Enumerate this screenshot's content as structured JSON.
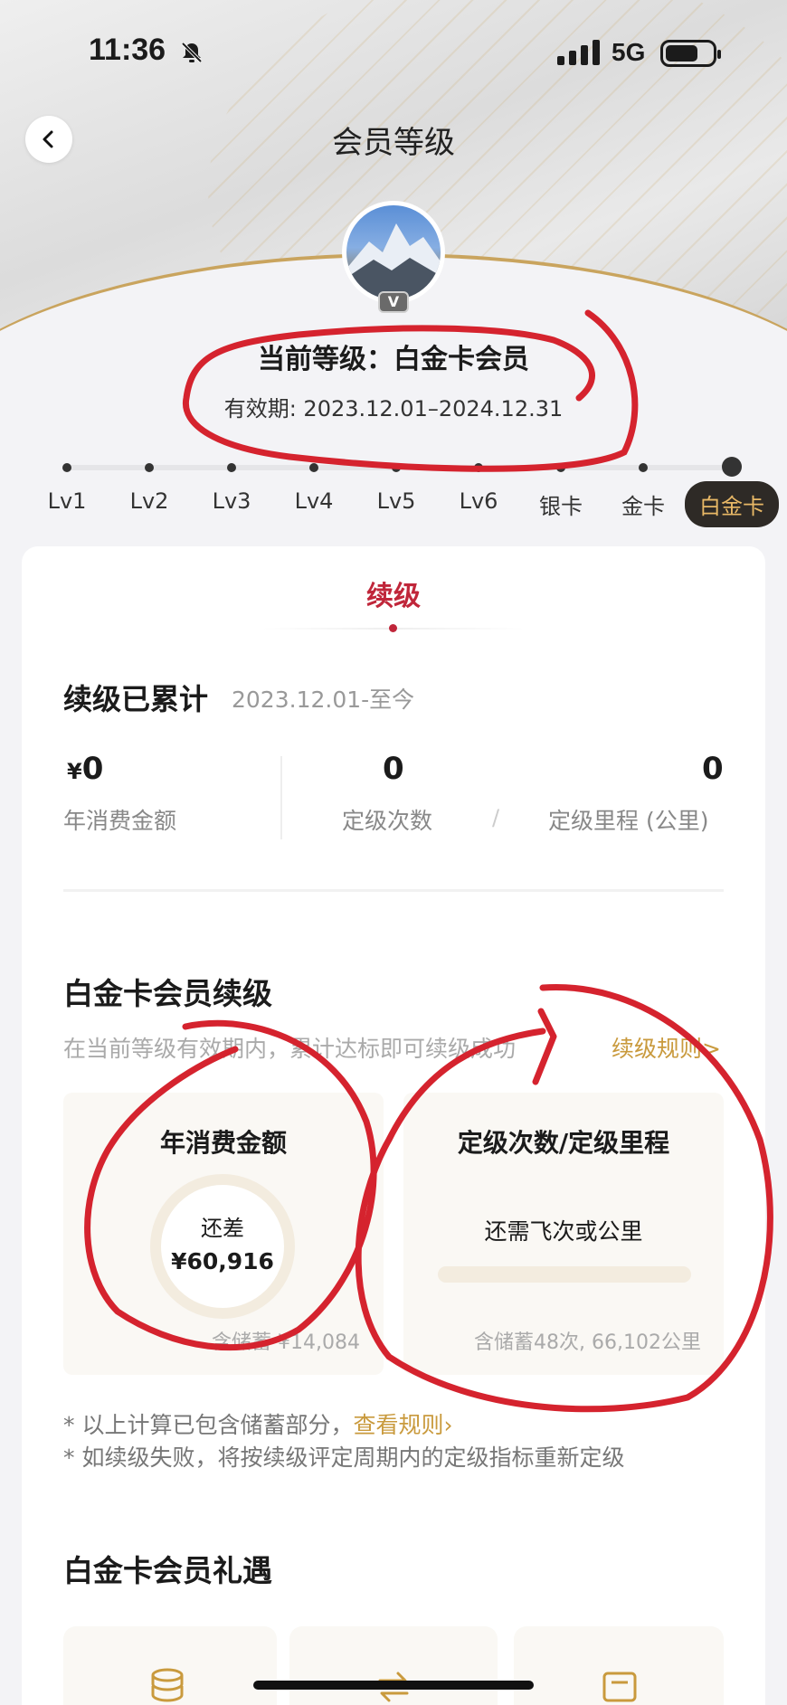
{
  "status_bar": {
    "time": "11:36",
    "network": "5G"
  },
  "nav": {
    "title": "会员等级"
  },
  "member": {
    "level_title": "当前等级：白金卡会员",
    "validity": "有效期: 2023.12.01–2024.12.31",
    "badge": "V"
  },
  "levels": [
    "Lv1",
    "Lv2",
    "Lv3",
    "Lv4",
    "Lv5",
    "Lv6",
    "银卡",
    "金卡",
    "白金卡"
  ],
  "tab": {
    "label": "续级"
  },
  "accumulated": {
    "heading": "续级已累计",
    "period": "2023.12.01-至今",
    "stats": [
      {
        "value": "0",
        "prefix": "¥",
        "label": "年消费金额"
      },
      {
        "value": "0",
        "label": "定级次数"
      },
      {
        "value": "0",
        "label": "定级里程 (公里)"
      }
    ]
  },
  "renewal": {
    "heading": "白金卡会员续级",
    "description": "在当前等级有效期内，累计达标即可续级成功",
    "rules_link": "续级规则>",
    "spend_panel": {
      "title": "年消费金额",
      "gap_label": "还差",
      "gap_value": "¥60,916",
      "footer": "含储蓄 ¥14,084"
    },
    "segment_panel": {
      "title": "定级次数/定级里程",
      "need_label": "还需飞次或公里",
      "progress": 0,
      "footer": "含储蓄48次, 66,102公里"
    }
  },
  "notes": {
    "line1": "* 以上计算已包含储蓄部分，",
    "line1_link": "查看规则›",
    "line2": "* 如续级失败，将按续级评定周期内的定级指标重新定级"
  },
  "gifts": {
    "heading": "白金卡会员礼遇"
  },
  "colors": {
    "accent_red": "#c0263a",
    "gold": "#c99a3d",
    "annotation_red": "#d5232e"
  }
}
